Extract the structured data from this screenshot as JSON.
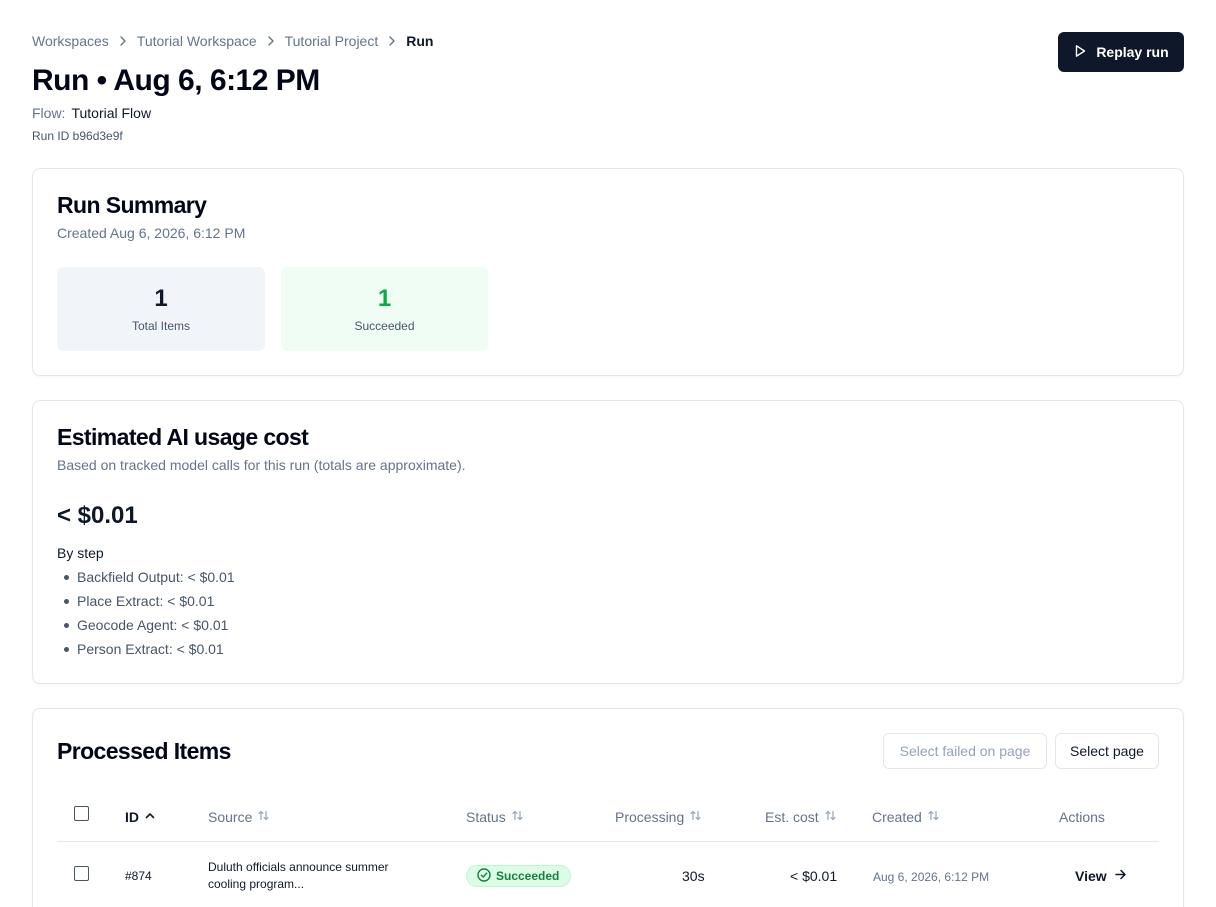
{
  "breadcrumb": {
    "items": [
      "Workspaces",
      "Tutorial Workspace",
      "Tutorial Project"
    ],
    "current": "Run"
  },
  "header": {
    "title": "Run • Aug 6, 6:12 PM",
    "flow_label": "Flow:",
    "flow_name": "Tutorial Flow",
    "run_id": "Run ID b96d3e9f",
    "replay_button": "Replay run"
  },
  "summary": {
    "title": "Run Summary",
    "created": "Created Aug 6, 2026, 6:12 PM",
    "stats": [
      {
        "value": "1",
        "label": "Total Items"
      },
      {
        "value": "1",
        "label": "Succeeded"
      }
    ]
  },
  "cost": {
    "title": "Estimated AI usage cost",
    "subtitle": "Based on tracked model calls for this run (totals are approximate).",
    "total": "< $0.01",
    "by_step_label": "By step",
    "steps": [
      "Backfield Output: < $0.01",
      "Place Extract: < $0.01",
      "Geocode Agent: < $0.01",
      "Person Extract: < $0.01"
    ]
  },
  "items": {
    "title": "Processed Items",
    "select_failed_button": "Select failed on page",
    "select_page_button": "Select page",
    "columns": {
      "id": "ID",
      "source": "Source",
      "status": "Status",
      "processing": "Processing",
      "cost": "Est. cost",
      "created": "Created",
      "actions": "Actions"
    },
    "rows": [
      {
        "id": "#874",
        "source": "Duluth officials announce summer cooling program...",
        "status": "Succeeded",
        "processing": "30s",
        "cost": "< $0.01",
        "created": "Aug 6, 2026, 6:12 PM",
        "action": "View"
      }
    ]
  },
  "colors": {
    "primary": "#0f172a",
    "success": "#16a34a",
    "success_bg": "#f0fdf4",
    "muted": "#64748b",
    "border": "#e2e8f0"
  }
}
